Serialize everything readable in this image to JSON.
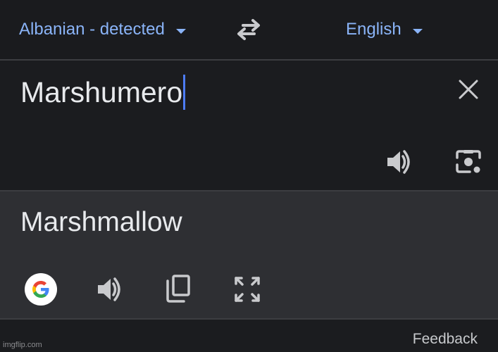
{
  "language_bar": {
    "source_language": "Albanian - detected",
    "target_language": "English",
    "swap_icon": "swap-arrows-icon"
  },
  "input": {
    "text": "Marshumero",
    "clear_icon": "close-icon",
    "listen_icon": "speaker-icon",
    "camera_icon": "camera-icon"
  },
  "output": {
    "text": "Marshmallow",
    "google_icon": "google-logo-icon",
    "listen_icon": "speaker-icon",
    "copy_icon": "copy-icon",
    "fullscreen_icon": "fullscreen-icon"
  },
  "footer": {
    "feedback": "Feedback",
    "watermark": "imgflip.com"
  },
  "colors": {
    "accent": "#8ab4f8",
    "cursor": "#4d7cf4",
    "background": "#1b1c1f",
    "output_background": "#2e2f33",
    "text": "#e8eaed",
    "icon": "#c9cacd"
  }
}
